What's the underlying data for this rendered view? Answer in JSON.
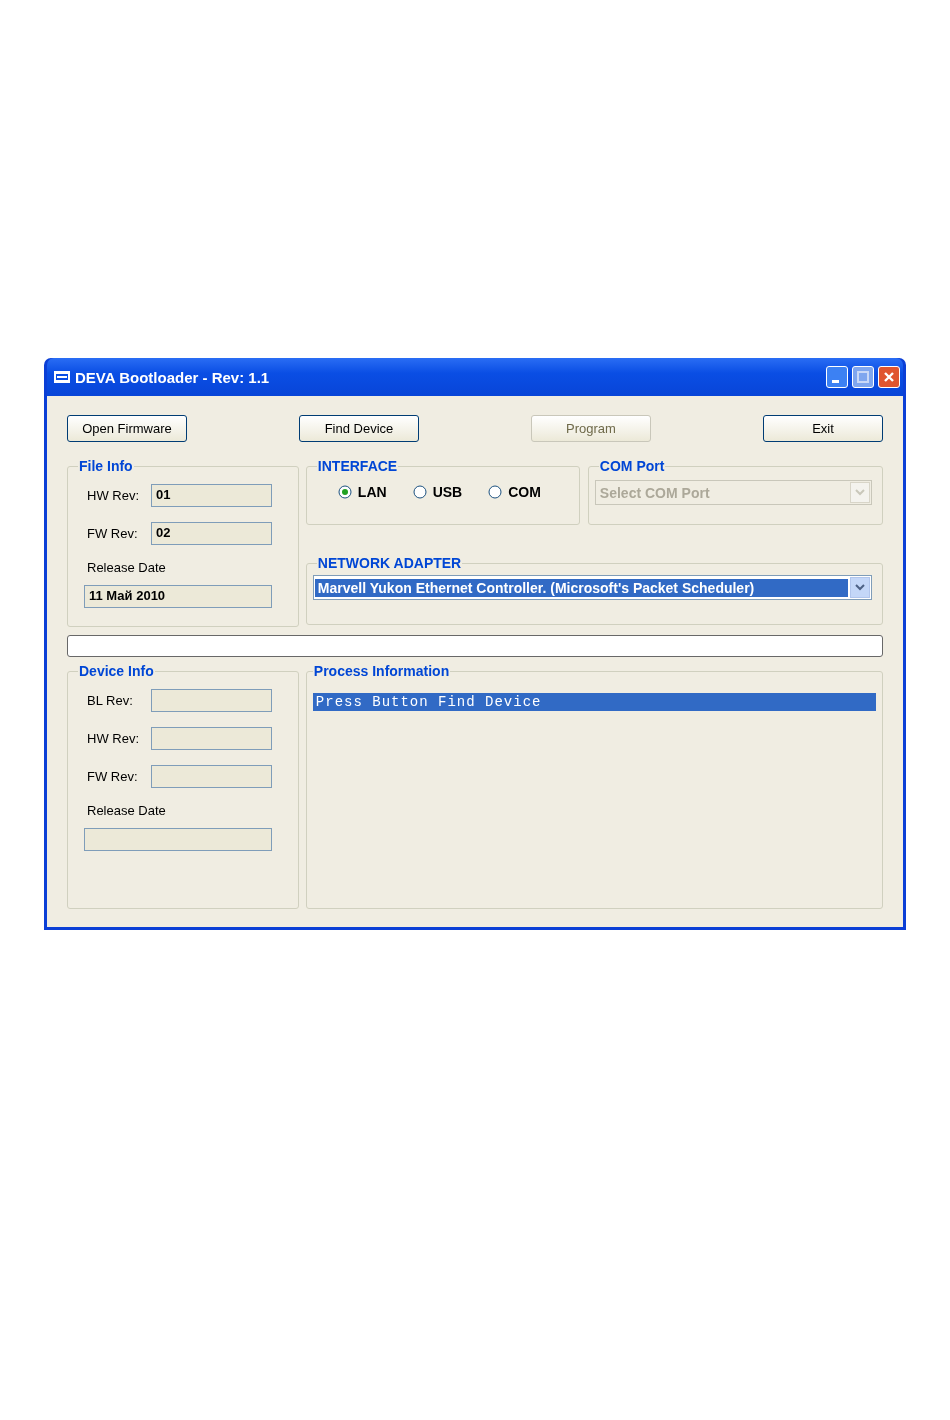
{
  "window": {
    "title": "DEVA Bootloader - Rev: 1.1"
  },
  "buttons": [
    {
      "label": "Open Firmware",
      "disabled": false
    },
    {
      "label": "Find Device",
      "disabled": false
    },
    {
      "label": "Program",
      "disabled": true
    },
    {
      "label": "Exit",
      "disabled": false
    }
  ],
  "file_info": {
    "title": "File Info",
    "fields": [
      {
        "label": "HW Rev:",
        "value": "01"
      },
      {
        "label": "FW Rev:",
        "value": "02"
      }
    ],
    "release_date": {
      "label": "Release Date",
      "value": "11 Май 2010"
    }
  },
  "interface": {
    "title": "INTERFACE",
    "options": [
      {
        "label": "LAN",
        "selected": true
      },
      {
        "label": "USB",
        "selected": false
      },
      {
        "label": "COM",
        "selected": false
      }
    ]
  },
  "com_port": {
    "title": "COM Port",
    "value": "Select COM Port",
    "disabled": true
  },
  "network_adapter": {
    "title": "NETWORK ADAPTER",
    "value": "Marvell Yukon Ethernet Controller. (Microsoft's Packet Scheduler)",
    "selected": true
  },
  "progress": {
    "level": 0
  },
  "device_info": {
    "title": "Device Info",
    "fields": [
      {
        "label": "BL Rev:"
      },
      {
        "label": "HW Rev:"
      },
      {
        "label": "FW Rev:"
      }
    ],
    "release_date": {
      "label": "Release Date"
    }
  },
  "process_information": {
    "title": "Process Information",
    "lines": [
      {
        "text": "Press Button Find Device",
        "selected": true
      }
    ]
  }
}
